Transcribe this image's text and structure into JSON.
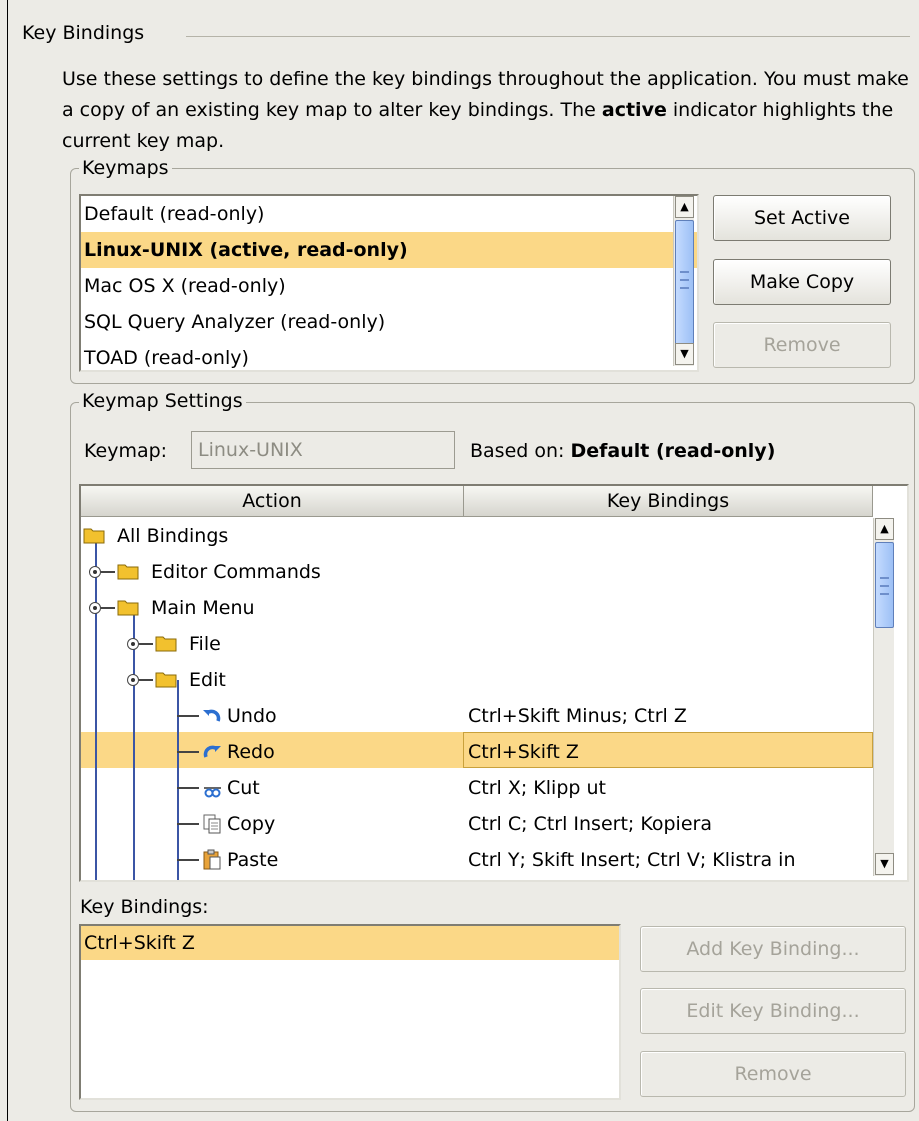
{
  "section": {
    "title": "Key Bindings",
    "intro_part1": "Use these settings to define the key bindings throughout the application. You must make a copy of an existing key map to alter key bindings. The ",
    "intro_bold": "active",
    "intro_part2": " indicator highlights the current key map."
  },
  "keymaps": {
    "legend": "Keymaps",
    "items": [
      {
        "label": "Default  (read-only)",
        "selected": false
      },
      {
        "label": "Linux-UNIX  (active, read-only)",
        "selected": true
      },
      {
        "label": "Mac OS X  (read-only)",
        "selected": false
      },
      {
        "label": "SQL Query Analyzer  (read-only)",
        "selected": false
      },
      {
        "label": "TOAD  (read-only)",
        "selected": false
      }
    ],
    "buttons": {
      "set_active": "Set Active",
      "make_copy": "Make Copy",
      "remove": "Remove"
    }
  },
  "settings": {
    "legend": "Keymap Settings",
    "keymap_label": "Keymap:",
    "keymap_value": "Linux-UNIX",
    "based_on_label": "Based on: ",
    "based_on_value": "Default (read-only)",
    "columns": {
      "action": "Action",
      "bindings": "Key Bindings"
    },
    "tree": [
      {
        "label": "All Bindings",
        "bindings": "",
        "icon": "folder-icon"
      },
      {
        "label": "Editor Commands",
        "bindings": "",
        "icon": "folder-icon"
      },
      {
        "label": "Main Menu",
        "bindings": "",
        "icon": "folder-icon"
      },
      {
        "label": "File",
        "bindings": "",
        "icon": "folder-icon"
      },
      {
        "label": "Edit",
        "bindings": "",
        "icon": "folder-icon"
      },
      {
        "label": "Undo",
        "bindings": "Ctrl+Skift Minus; Ctrl Z",
        "icon": "undo-icon"
      },
      {
        "label": "Redo",
        "bindings": "Ctrl+Skift Z",
        "icon": "redo-icon",
        "selected": true
      },
      {
        "label": "Cut",
        "bindings": "Ctrl X; Klipp ut",
        "icon": "scissors-icon"
      },
      {
        "label": "Copy",
        "bindings": "Ctrl C; Ctrl Insert; Kopiera",
        "icon": "copy-icon"
      },
      {
        "label": "Paste",
        "bindings": "Ctrl Y; Skift Insert; Ctrl V; Klistra in",
        "icon": "paste-icon"
      }
    ],
    "key_bindings_label": "Key Bindings:",
    "key_bindings_items": [
      "Ctrl+Skift Z"
    ],
    "buttons": {
      "add": "Add Key Binding...",
      "edit": "Edit Key Binding...",
      "remove": "Remove"
    }
  },
  "colors": {
    "selection": "#fbd887",
    "tree_lines": "#3b55a5",
    "folder": "#f2c12e"
  }
}
